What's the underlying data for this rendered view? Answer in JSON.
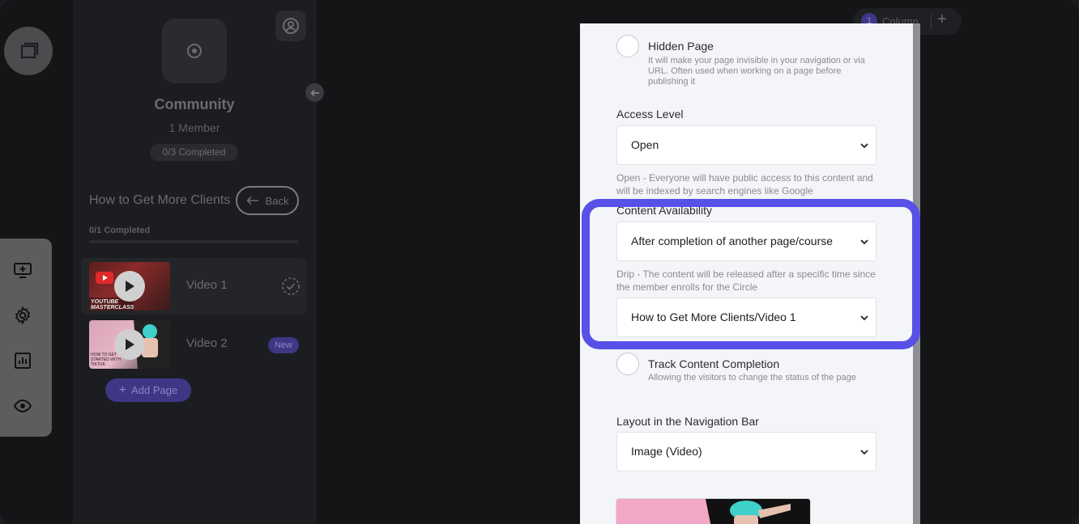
{
  "sidebar": {
    "community_title": "Community",
    "member_count": "1 Member",
    "community_progress": "0/3 Completed",
    "course_title": "How to Get More Clients",
    "back_label": "Back",
    "course_progress": "0/1 Completed",
    "lessons": [
      {
        "label": "Video 1",
        "thumb_text": "YOUTUBE MASTERCLASS",
        "status": "check"
      },
      {
        "label": "Video 2",
        "thumb_text": "HOW TO GET STARTED WITH TIKTOK",
        "badge": "New"
      }
    ],
    "add_page_label": "Add Page"
  },
  "column_pill": {
    "number": "1",
    "label": "Column"
  },
  "panel": {
    "hidden_page": {
      "title": "Hidden Page",
      "description": "It will make your page invisible in your navigation or via URL. Often used when working on a page before publishing it"
    },
    "access_level": {
      "label": "Access Level",
      "value": "Open",
      "help": "Open - Everyone will have public access to this content and will be indexed by search engines like Google"
    },
    "content_availability": {
      "label": "Content Availability",
      "value": "After completion of another page/course",
      "help": "Drip - The content will be released after a specific time since the member enrolls for the Circle",
      "dependency_value": "How to Get More Clients/Video 1"
    },
    "track_completion": {
      "title": "Track Content Completion",
      "description": "Allowing the visitors to change the status of the page"
    },
    "nav_layout": {
      "label": "Layout in the Navigation Bar",
      "value": "Image (Video)"
    }
  },
  "colors": {
    "accent": "#5751e8",
    "panel_bg": "#f4f5f9",
    "dark_bg": "#141517"
  }
}
